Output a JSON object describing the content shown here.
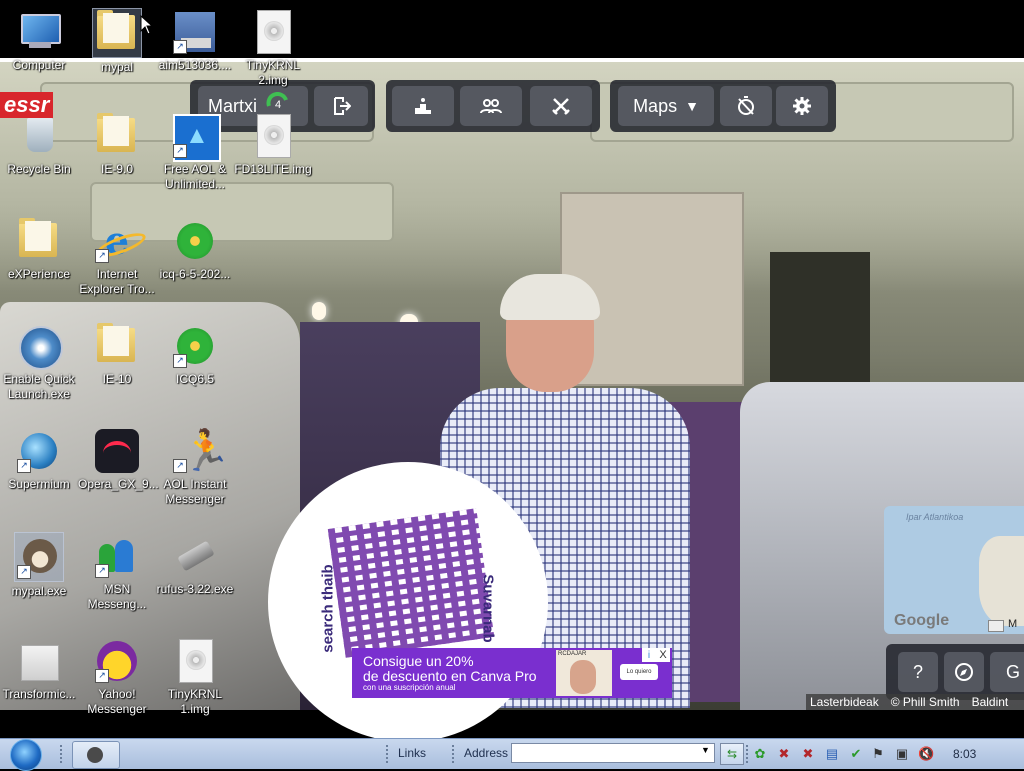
{
  "desktop": {
    "icons": [
      {
        "label": "Computer",
        "icon": "computer-icon"
      },
      {
        "label": "mypal",
        "icon": "folder-icon"
      },
      {
        "label": "aim513036....",
        "icon": "installer-icon"
      },
      {
        "label": "TinyKRNL 2.img",
        "icon": "disc-image-icon"
      },
      {
        "label": "Recycle Bin",
        "icon": "recycle-bin-icon"
      },
      {
        "label": "IE-9.0",
        "icon": "folder-icon"
      },
      {
        "label": "Free AOL & Unlimited...",
        "icon": "aol-icon"
      },
      {
        "label": "FD13LITE.img",
        "icon": "disc-image-icon"
      },
      {
        "label": "eXPerience",
        "icon": "folder-icon"
      },
      {
        "label": "Internet Explorer Tro...",
        "icon": "internet-explorer-icon"
      },
      {
        "label": "icq-6-5-202...",
        "icon": "icq-installer-icon"
      },
      {
        "label": "Enable Quick Launch.exe",
        "icon": "quick-launch-icon"
      },
      {
        "label": "IE-10",
        "icon": "folder-icon"
      },
      {
        "label": "ICQ6.5",
        "icon": "icq-icon"
      },
      {
        "label": "Supermium",
        "icon": "supermium-icon"
      },
      {
        "label": "Opera_GX_9...",
        "icon": "opera-gx-icon"
      },
      {
        "label": "AOL Instant Messenger",
        "icon": "aim-icon"
      },
      {
        "label": "mypal.exe",
        "icon": "mypal-raccoon-icon"
      },
      {
        "label": "MSN Messeng...",
        "icon": "msn-messenger-icon"
      },
      {
        "label": "rufus-3.22.exe",
        "icon": "usb-drive-icon"
      },
      {
        "label": "Transformic...",
        "icon": "box-icon"
      },
      {
        "label": "Yahoo! Messenger",
        "icon": "yahoo-messenger-icon"
      },
      {
        "label": "TinyKRNL 1.img",
        "icon": "disc-image-icon"
      }
    ],
    "overlay_logo": "essr"
  },
  "game": {
    "player_name": "Martxi",
    "score_badge": "4",
    "maps_label": "Maps",
    "toolbar_icons": [
      "exit-icon",
      "podium-icon",
      "group-icon",
      "swords-icon",
      "no-timer-icon",
      "gear-icon"
    ],
    "minimap_label": "Ipar Atlantikoa",
    "minimap_logo": "Google",
    "minimap_extra": "M",
    "help_label": "?",
    "bottom_extra": "G",
    "credits": [
      "Lasterbideak",
      "© Phill Smith",
      "Baldint"
    ]
  },
  "scene": {
    "sign_text_1": "search thaib",
    "sign_text_2": "Suvarnab"
  },
  "ad": {
    "line1": "Consigue un 20%",
    "line2": "de descuento en Canva Pro",
    "line3": "con una suscripción anual",
    "brand": "RCDAJAR",
    "cta": "Lo quiero",
    "info": "i",
    "close": "X"
  },
  "taskbar": {
    "links_label": "Links",
    "address_label": "Address",
    "address_value": "",
    "clock": "8:03"
  }
}
